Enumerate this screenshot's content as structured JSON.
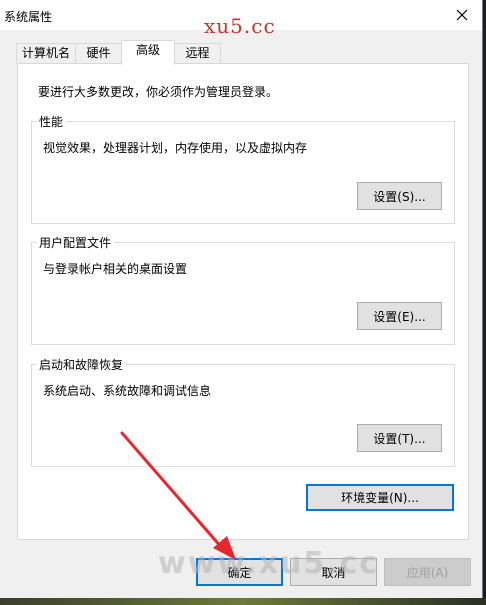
{
  "window": {
    "title": "系统属性"
  },
  "tabs": [
    {
      "label": "计算机名"
    },
    {
      "label": "硬件"
    },
    {
      "label": "高级"
    },
    {
      "label": "远程"
    }
  ],
  "active_tab": "高级",
  "intro_text": "要进行大多数更改，你必须作为管理员登录。",
  "groups": {
    "performance": {
      "title": "性能",
      "desc": "视觉效果，处理器计划，内存使用，以及虚拟内存",
      "button": "设置(S)..."
    },
    "user_profiles": {
      "title": "用户配置文件",
      "desc": "与登录帐户相关的桌面设置",
      "button": "设置(E)..."
    },
    "startup_recovery": {
      "title": "启动和故障恢复",
      "desc": "系统启动、系统故障和调试信息",
      "button": "设置(T)..."
    }
  },
  "env_button": "环境变量(N)...",
  "footer": {
    "ok": "确定",
    "cancel": "取消",
    "apply": "应用(A)"
  },
  "watermarks": {
    "top": "xu5.cc",
    "bottom": "www.xu5.cc"
  },
  "colors": {
    "arrow": "#e8262b",
    "focus_border": "#0078d7",
    "watermark_top": "#c0392b"
  },
  "icons": {
    "close": "close-icon"
  }
}
